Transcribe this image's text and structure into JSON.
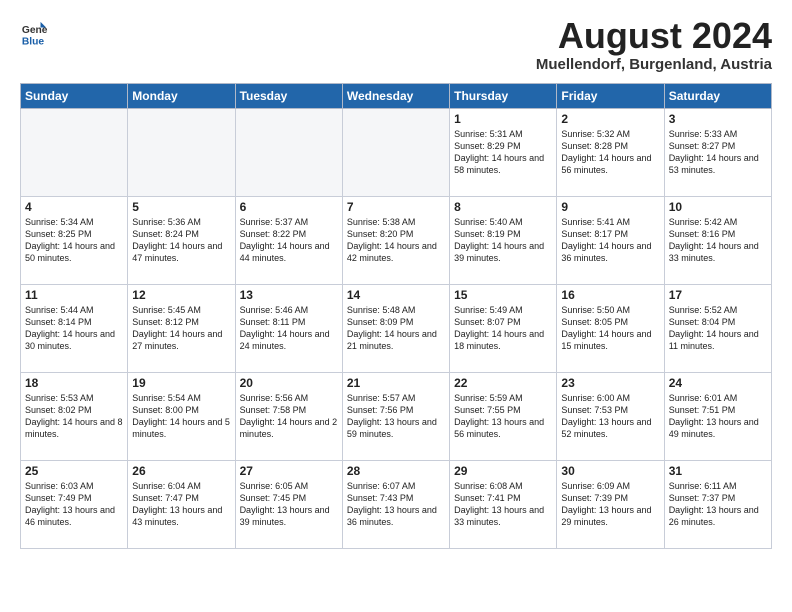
{
  "header": {
    "logo_line1": "General",
    "logo_line2": "Blue",
    "month_year": "August 2024",
    "location": "Muellendorf, Burganland, Austria"
  },
  "days_of_week": [
    "Sunday",
    "Monday",
    "Tuesday",
    "Wednesday",
    "Thursday",
    "Friday",
    "Saturday"
  ],
  "weeks": [
    [
      {
        "day": "",
        "info": ""
      },
      {
        "day": "",
        "info": ""
      },
      {
        "day": "",
        "info": ""
      },
      {
        "day": "",
        "info": ""
      },
      {
        "day": "1",
        "info": "Sunrise: 5:31 AM\nSunset: 8:29 PM\nDaylight: 14 hours\nand 58 minutes."
      },
      {
        "day": "2",
        "info": "Sunrise: 5:32 AM\nSunset: 8:28 PM\nDaylight: 14 hours\nand 56 minutes."
      },
      {
        "day": "3",
        "info": "Sunrise: 5:33 AM\nSunset: 8:27 PM\nDaylight: 14 hours\nand 53 minutes."
      }
    ],
    [
      {
        "day": "4",
        "info": "Sunrise: 5:34 AM\nSunset: 8:25 PM\nDaylight: 14 hours\nand 50 minutes."
      },
      {
        "day": "5",
        "info": "Sunrise: 5:36 AM\nSunset: 8:24 PM\nDaylight: 14 hours\nand 47 minutes."
      },
      {
        "day": "6",
        "info": "Sunrise: 5:37 AM\nSunset: 8:22 PM\nDaylight: 14 hours\nand 44 minutes."
      },
      {
        "day": "7",
        "info": "Sunrise: 5:38 AM\nSunset: 8:20 PM\nDaylight: 14 hours\nand 42 minutes."
      },
      {
        "day": "8",
        "info": "Sunrise: 5:40 AM\nSunset: 8:19 PM\nDaylight: 14 hours\nand 39 minutes."
      },
      {
        "day": "9",
        "info": "Sunrise: 5:41 AM\nSunset: 8:17 PM\nDaylight: 14 hours\nand 36 minutes."
      },
      {
        "day": "10",
        "info": "Sunrise: 5:42 AM\nSunset: 8:16 PM\nDaylight: 14 hours\nand 33 minutes."
      }
    ],
    [
      {
        "day": "11",
        "info": "Sunrise: 5:44 AM\nSunset: 8:14 PM\nDaylight: 14 hours\nand 30 minutes."
      },
      {
        "day": "12",
        "info": "Sunrise: 5:45 AM\nSunset: 8:12 PM\nDaylight: 14 hours\nand 27 minutes."
      },
      {
        "day": "13",
        "info": "Sunrise: 5:46 AM\nSunset: 8:11 PM\nDaylight: 14 hours\nand 24 minutes."
      },
      {
        "day": "14",
        "info": "Sunrise: 5:48 AM\nSunset: 8:09 PM\nDaylight: 14 hours\nand 21 minutes."
      },
      {
        "day": "15",
        "info": "Sunrise: 5:49 AM\nSunset: 8:07 PM\nDaylight: 14 hours\nand 18 minutes."
      },
      {
        "day": "16",
        "info": "Sunrise: 5:50 AM\nSunset: 8:05 PM\nDaylight: 14 hours\nand 15 minutes."
      },
      {
        "day": "17",
        "info": "Sunrise: 5:52 AM\nSunset: 8:04 PM\nDaylight: 14 hours\nand 11 minutes."
      }
    ],
    [
      {
        "day": "18",
        "info": "Sunrise: 5:53 AM\nSunset: 8:02 PM\nDaylight: 14 hours\nand 8 minutes."
      },
      {
        "day": "19",
        "info": "Sunrise: 5:54 AM\nSunset: 8:00 PM\nDaylight: 14 hours\nand 5 minutes."
      },
      {
        "day": "20",
        "info": "Sunrise: 5:56 AM\nSunset: 7:58 PM\nDaylight: 14 hours\nand 2 minutes."
      },
      {
        "day": "21",
        "info": "Sunrise: 5:57 AM\nSunset: 7:56 PM\nDaylight: 13 hours\nand 59 minutes."
      },
      {
        "day": "22",
        "info": "Sunrise: 5:59 AM\nSunset: 7:55 PM\nDaylight: 13 hours\nand 56 minutes."
      },
      {
        "day": "23",
        "info": "Sunrise: 6:00 AM\nSunset: 7:53 PM\nDaylight: 13 hours\nand 52 minutes."
      },
      {
        "day": "24",
        "info": "Sunrise: 6:01 AM\nSunset: 7:51 PM\nDaylight: 13 hours\nand 49 minutes."
      }
    ],
    [
      {
        "day": "25",
        "info": "Sunrise: 6:03 AM\nSunset: 7:49 PM\nDaylight: 13 hours\nand 46 minutes."
      },
      {
        "day": "26",
        "info": "Sunrise: 6:04 AM\nSunset: 7:47 PM\nDaylight: 13 hours\nand 43 minutes."
      },
      {
        "day": "27",
        "info": "Sunrise: 6:05 AM\nSunset: 7:45 PM\nDaylight: 13 hours\nand 39 minutes."
      },
      {
        "day": "28",
        "info": "Sunrise: 6:07 AM\nSunset: 7:43 PM\nDaylight: 13 hours\nand 36 minutes."
      },
      {
        "day": "29",
        "info": "Sunrise: 6:08 AM\nSunset: 7:41 PM\nDaylight: 13 hours\nand 33 minutes."
      },
      {
        "day": "30",
        "info": "Sunrise: 6:09 AM\nSunset: 7:39 PM\nDaylight: 13 hours\nand 29 minutes."
      },
      {
        "day": "31",
        "info": "Sunrise: 6:11 AM\nSunset: 7:37 PM\nDaylight: 13 hours\nand 26 minutes."
      }
    ]
  ]
}
